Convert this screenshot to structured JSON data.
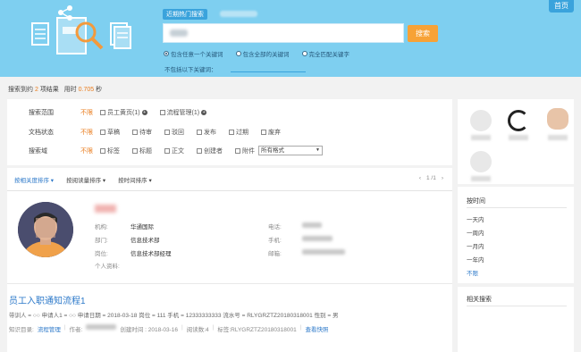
{
  "header": {
    "home_label": "首页",
    "hot_search_label": "近期热门搜索",
    "search_button": "搜索",
    "match_options": [
      "包含任意一个关键词",
      "包含全部的关键词",
      "完全匹配关键字"
    ],
    "selected_match": 0,
    "exclude_label": "不包括以下关键词："
  },
  "results_summary": {
    "prefix": "搜索到约",
    "count": "2",
    "unit": "项结果",
    "time_label": "用时",
    "time_value": "0.705",
    "time_unit": "秒"
  },
  "filters": {
    "unlimited": "不限",
    "rows": [
      {
        "label": "搜索范围",
        "options": [
          "员工黄页(1)",
          "流程管理(1)"
        ]
      },
      {
        "label": "文档状态",
        "options": [
          "草稿",
          "待审",
          "驳回",
          "发布",
          "过期",
          "废弃"
        ]
      },
      {
        "label": "搜索域",
        "options": [
          "标签",
          "标题",
          "正文",
          "创建者",
          "附件"
        ]
      }
    ],
    "format_select": "所有格式"
  },
  "sort": {
    "options": [
      "按相关度排序",
      "按阅读量排序",
      "按时间排序"
    ],
    "pager": "1 /1",
    "prev": "‹",
    "next": "›"
  },
  "person": {
    "org_label": "机构:",
    "org_value": "华通国际",
    "dept_label": "部门:",
    "dept_value": "信息技术部",
    "post_label": "岗位:",
    "post_value": "信息技术部经理",
    "profile_label": "个人资料:",
    "phone_label": "电话:",
    "mobile_label": "手机:",
    "email_label": "邮箱:"
  },
  "result": {
    "title": "员工入职通知流程1",
    "snippet": "带训人 = ○○ 申请人1 = ○○ 申请日期 = 2018-03-18 岗位 = 111 手机 = 12333333333 流水号 = RLYGRZTZ20180318001 性别 = 男",
    "dir_label": "知识目录:",
    "dir_value": "流程管理",
    "author_label": "作者:",
    "created_label": "创建时间 : 2018-03-16",
    "reads_label": "阅读数:4",
    "tags_label": "标签:RLYGRZTZ20180318001",
    "snapshot": "查看快照"
  },
  "sidebar": {
    "time_title": "按时间",
    "time_options": [
      "一天内",
      "一周内",
      "一月内",
      "一年内",
      "不限"
    ],
    "selected_time": 4,
    "related_title": "相关搜索"
  },
  "colors": {
    "header_bg": "#7ecff0",
    "accent_blue": "#2b78c9",
    "accent_orange": "#f7a236",
    "highlight_orange": "#e97b1b"
  }
}
